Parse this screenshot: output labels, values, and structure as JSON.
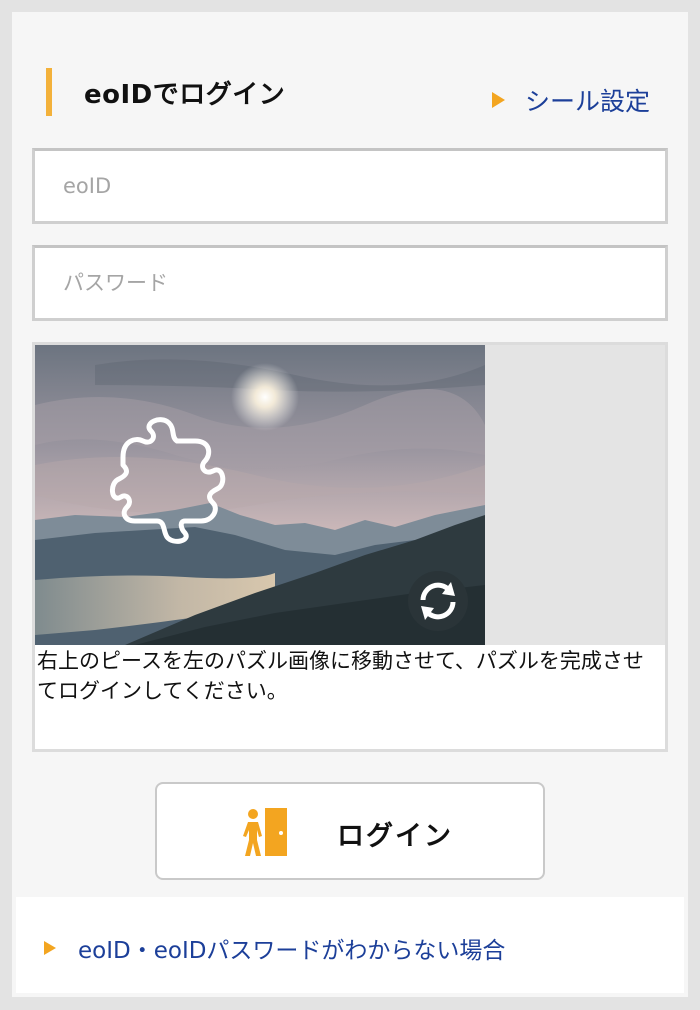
{
  "header": {
    "title": "eoIDでログイン",
    "seal_link_label": "シール設定"
  },
  "form": {
    "eoid_placeholder": "eoID",
    "password_placeholder": "パスワード"
  },
  "captcha": {
    "instruction": "右上のピースを左のパズル画像に移動させて、パズルを完成させてログインしてください。"
  },
  "login": {
    "button_label": "ログイン"
  },
  "help": {
    "link_label": "eoID・eoIDパスワードがわからない場合"
  },
  "icons": {
    "link_arrow": "triangle-right-icon",
    "login": "door-exit-icon",
    "refresh": "refresh-icon",
    "puzzle": "puzzle-piece-outline"
  },
  "colors": {
    "accent": "#f3b13a",
    "link": "#1c3f99",
    "background": "#e3e3e3"
  }
}
